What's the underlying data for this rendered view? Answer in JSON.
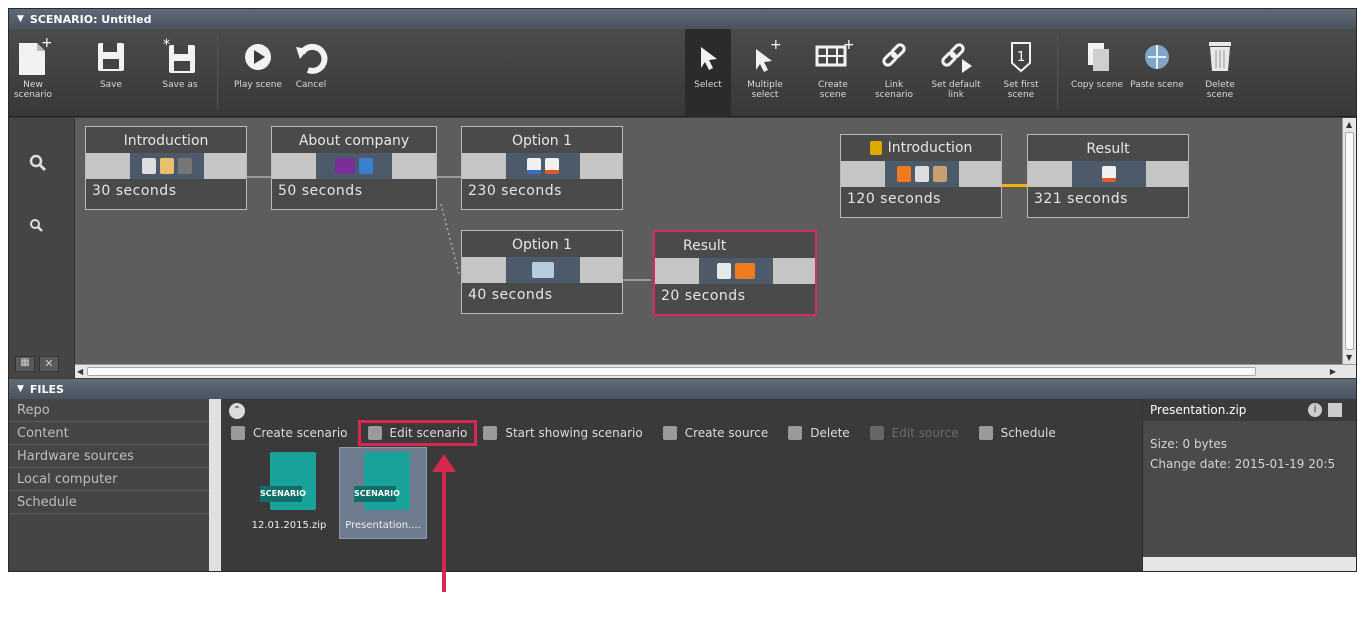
{
  "scenario_panel": {
    "title": "SCENARIO: Untitled"
  },
  "toolbar": {
    "new_scenario": "New\nscenario",
    "save": "Save",
    "save_as": "Save as",
    "play_scene": "Play scene",
    "cancel": "Cancel",
    "select": "Select",
    "multiple_select": "Multiple\nselect",
    "create_scene": "Create\nscene",
    "link_scenario": "Link\nscenario",
    "set_default_link": "Set default\nlink",
    "set_first_scene": "Set first\nscene",
    "copy_scene": "Copy scene",
    "paste_scene": "Paste scene",
    "delete_scene": "Delete\nscene"
  },
  "nodes": [
    {
      "title": "Introduction",
      "duration": "30  seconds"
    },
    {
      "title": "About company",
      "duration": "50  seconds"
    },
    {
      "title": "Option 1",
      "duration": "230 seconds"
    },
    {
      "title": "Option 1",
      "duration": "40  seconds"
    },
    {
      "title": "Result",
      "duration": "20  seconds"
    },
    {
      "title": "Introduction",
      "duration": "120 seconds"
    },
    {
      "title": "Result",
      "duration": "321 seconds"
    }
  ],
  "files_panel": {
    "title": "FILES"
  },
  "nav": [
    "Repo",
    "Content",
    "Hardware sources",
    "Local computer",
    "Schedule"
  ],
  "actions": {
    "create_scenario": "Create scenario",
    "edit_scenario": "Edit scenario",
    "start_showing": "Start showing scenario",
    "create_source": "Create source",
    "delete": "Delete",
    "edit_source": "Edit source",
    "schedule": "Schedule"
  },
  "files": [
    {
      "name": "12.01.2015.zip",
      "badge": "SCENARIO"
    },
    {
      "name": "Presentation....",
      "badge": "SCENARIO"
    }
  ],
  "info": {
    "title": "Presentation.zip",
    "size": "Size: 0 bytes",
    "change_date": "Change date: 2015-01-19 20:5"
  },
  "colors": {
    "accent_callout": "#d7294e",
    "selected_node_border": "#d52b6c",
    "default_link_arrow": "#f0b400",
    "file_icon": "#1aa39a"
  }
}
